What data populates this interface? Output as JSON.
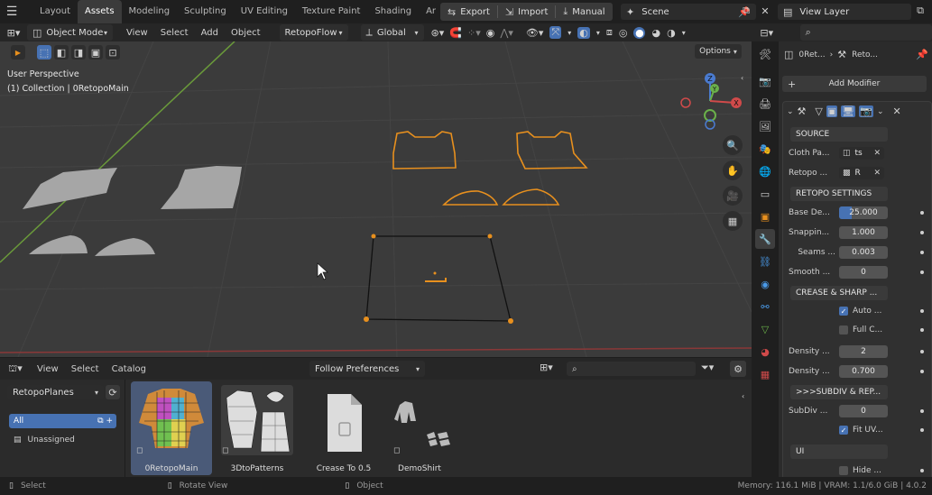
{
  "topbar": {
    "tabs": [
      "Layout",
      "Assets",
      "Modeling",
      "Sculpting",
      "UV Editing",
      "Texture Paint",
      "Shading",
      "Ar"
    ],
    "active_tab": "Assets",
    "export_label": "Export",
    "import_label": "Import",
    "manual_label": "Manual",
    "scene_label": "Scene",
    "view_layer_label": "View Layer"
  },
  "viewport_header": {
    "mode": "Object Mode",
    "menus": [
      "View",
      "Select",
      "Add",
      "Object"
    ],
    "retopo_flow": "RetopoFlow",
    "transform": "Global",
    "options": "Options"
  },
  "viewport": {
    "perspective": "User Perspective",
    "collection": "(1) Collection | 0RetopoMain",
    "gizmo_labels": {
      "z": "Z",
      "y": "Y",
      "x": "X"
    }
  },
  "asset_browser": {
    "menus": [
      "View",
      "Select",
      "Catalog"
    ],
    "follow": "Follow Preferences",
    "library": "RetopoPlanes",
    "catalogs": [
      {
        "label": "All",
        "selected": true
      },
      {
        "label": "Unassigned",
        "selected": false
      }
    ],
    "assets": [
      {
        "label": "0RetopoMain",
        "selected": true
      },
      {
        "label": "3DtoPatterns",
        "selected": false
      },
      {
        "label": "Crease To 0.5",
        "selected": false
      },
      {
        "label": "DemoShirt",
        "selected": false
      }
    ]
  },
  "statusbar": {
    "select": "Select",
    "rotate": "Rotate View",
    "object": "Object",
    "memory": "Memory: 116.1 MiB | VRAM: 1.1/6.0 GiB | 4.0.2"
  },
  "properties": {
    "breadcrumb_1": "0Ret...",
    "breadcrumb_2": "Reto...",
    "add_modifier": "Add Modifier",
    "source_section": "SOURCE",
    "cloth_pa_label": "Cloth Pa...",
    "cloth_pa_value": "ts",
    "retopo_label": "Retopo ...",
    "retopo_value": "R",
    "retopo_settings": "RETOPO SETTINGS",
    "base_label": "Base De...",
    "base_value": "25.000",
    "base_fill": 0.25,
    "snap_label": "Snappin...",
    "snap_value": "1.000",
    "seams_label": "Seams ...",
    "seams_value": "0.003",
    "smooth_label": "Smooth ...",
    "smooth_value": "0",
    "crease_section": "CREASE & SHARP ...",
    "auto_label": "Auto ...",
    "auto_checked": true,
    "fullc_label": "Full C...",
    "fullc_checked": false,
    "density1_label": "Density ...",
    "density1_value": "2",
    "density2_label": "Density ...",
    "density2_value": "0.700",
    "subdiv_section": ">>>SUBDIV & REP...",
    "subdiv_label": "SubDiv ...",
    "subdiv_value": "0",
    "fituv_label": "Fit UV...",
    "fituv_checked": true,
    "ui_section": "UI",
    "hide_label": "Hide ...",
    "hide_checked": false
  },
  "colors": {
    "accent_blue": "#4772b3",
    "selection_orange": "#e8901e",
    "viewport_bg": "#3b3b3b",
    "panel_bg": "#2b2b2b"
  }
}
